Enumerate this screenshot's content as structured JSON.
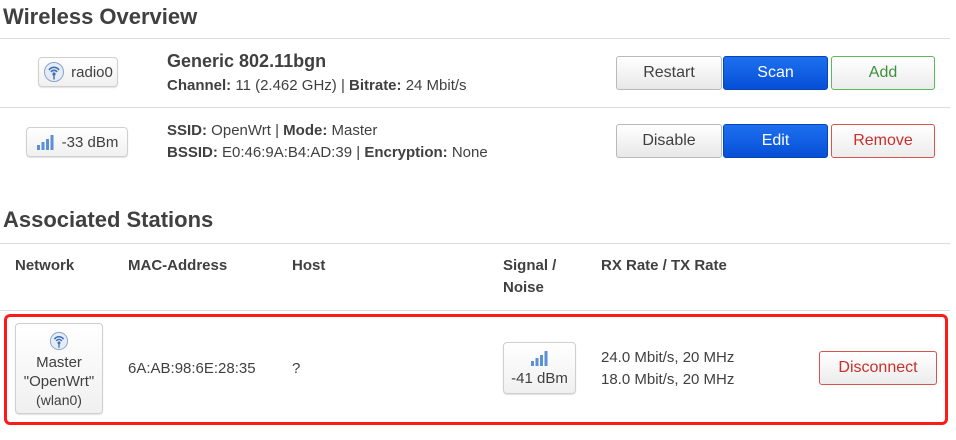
{
  "wireless_overview": {
    "heading": "Wireless Overview",
    "device": {
      "badge_label": "radio0",
      "title": "Generic 802.11bgn",
      "channel_label": "Channel:",
      "channel_value": " 11 (2.462 GHz) | ",
      "bitrate_label": "Bitrate:",
      "bitrate_value": " 24 Mbit/s",
      "buttons": {
        "restart": "Restart",
        "scan": "Scan",
        "add": "Add"
      }
    },
    "network": {
      "signal_badge": "-33 dBm",
      "ssid_label": "SSID:",
      "ssid_value": " OpenWrt | ",
      "mode_label": "Mode:",
      "mode_value": " Master",
      "bssid_label": "BSSID:",
      "bssid_value": " E0:46:9A:B4:AD:39 | ",
      "encryption_label": "Encryption:",
      "encryption_value": " None",
      "buttons": {
        "disable": "Disable",
        "edit": "Edit",
        "remove": "Remove"
      }
    }
  },
  "associated_stations": {
    "heading": "Associated Stations",
    "columns": {
      "network": "Network",
      "mac": "MAC-Address",
      "host": "Host",
      "signal_line1": "Signal /",
      "signal_line2": "Noise",
      "rate": "RX Rate / TX Rate"
    },
    "rows": [
      {
        "network_line1": "Master",
        "network_line2": "\"OpenWrt\"",
        "network_line3": "(wlan0)",
        "mac": "6A:AB:98:6E:28:35",
        "host": "?",
        "signal": "-41 dBm",
        "rx_rate": "24.0 Mbit/s, 20 MHz",
        "tx_rate": "18.0 Mbit/s, 20 MHz",
        "disconnect": "Disconnect"
      }
    ]
  },
  "icons": {
    "radio": "wifi-radio-icon",
    "signal": "signal-bars-icon"
  },
  "colors": {
    "primary_button": "#0650d6",
    "add_button_border": "#5cb85c",
    "remove_button_border": "#d9534f",
    "highlight_border": "#ff1a1a"
  }
}
